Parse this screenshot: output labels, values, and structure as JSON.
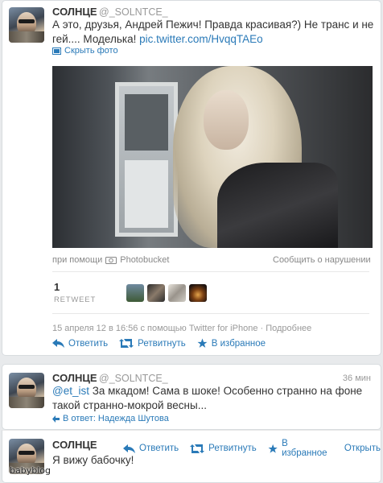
{
  "colors": {
    "link": "#2a7ab8",
    "text": "#333333",
    "muted": "#999999"
  },
  "tweets": [
    {
      "name": "СОЛНЦЕ",
      "handle": "@_SOLNTCE_",
      "text": "А это, друзья, Андрей Пежич! Правда красивая?) Не транс и не гей.... Моделька! ",
      "link": "pic.twitter.com/HvqqTAEo",
      "hide_photo": "Скрыть фото",
      "photo_credit_prefix": "при помощи",
      "photo_credit_source": "Photobucket",
      "report": "Сообщить о нарушении",
      "retweet_count": "1",
      "retweet_label": "RETWEET",
      "meta": "15 апреля 12 в 16:56 с помощью Twitter for iPhone · Подробнее",
      "actions": {
        "reply": "Ответить",
        "retweet": "Ретвитнуть",
        "favorite": "В избранное"
      }
    },
    {
      "name": "СОЛНЦЕ",
      "handle": "@_SOLNTCE_",
      "time": "36 мин",
      "mention": "@et_ist",
      "text": " За мкадом! Сама в шоке! Особенно странно на фоне такой странно-мокрой весны...",
      "in_reply": "В ответ: Надежда Шутова"
    },
    {
      "name": "СОЛНЦЕ",
      "text": "Я вижу бабочку!",
      "actions": {
        "reply": "Ответить",
        "retweet": "Ретвитнуть",
        "favorite": "В избранное",
        "open": "Открыть"
      }
    }
  ],
  "watermark": "babyblog"
}
